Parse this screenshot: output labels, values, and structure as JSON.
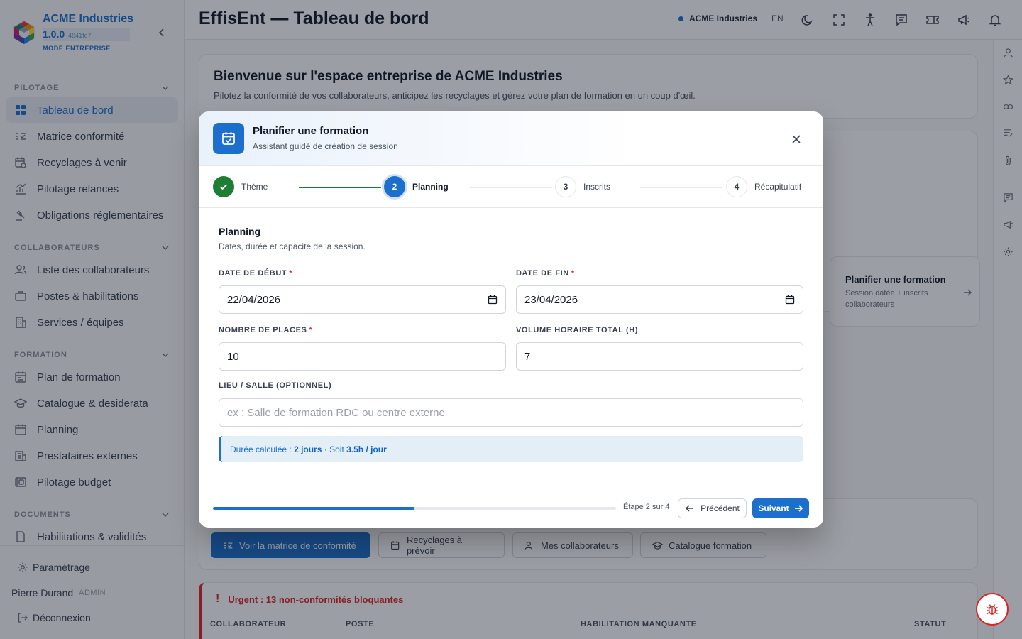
{
  "brand": {
    "name": "ACME Industries",
    "version": "1.0.0",
    "hash": "4841fd7",
    "mode": "MODE ENTREPRISE"
  },
  "sidebar": {
    "sections": [
      {
        "title": "PILOTAGE",
        "items": [
          {
            "label": "Tableau de bord",
            "icon": "dashboard-icon",
            "active": true
          },
          {
            "label": "Matrice conformité",
            "icon": "checklist-icon"
          },
          {
            "label": "Recyclages à venir",
            "icon": "calendar-refresh-icon"
          },
          {
            "label": "Pilotage relances",
            "icon": "chart-icon"
          },
          {
            "label": "Obligations réglementaires",
            "icon": "gavel-icon"
          }
        ]
      },
      {
        "title": "COLLABORATEURS",
        "items": [
          {
            "label": "Liste des collaborateurs",
            "icon": "users-icon"
          },
          {
            "label": "Postes & habilitations",
            "icon": "briefcase-icon"
          },
          {
            "label": "Services / équipes",
            "icon": "building-icon"
          }
        ]
      },
      {
        "title": "FORMATION",
        "items": [
          {
            "label": "Plan de formation",
            "icon": "calendar-plan-icon"
          },
          {
            "label": "Catalogue & desiderata",
            "icon": "graduation-cap-icon"
          },
          {
            "label": "Planning",
            "icon": "calendar-icon"
          },
          {
            "label": "Prestataires externes",
            "icon": "building-icon"
          },
          {
            "label": "Pilotage budget",
            "icon": "budget-icon"
          }
        ]
      },
      {
        "title": "DOCUMENTS",
        "items": [
          {
            "label": "Habilitations & validités",
            "icon": "document-icon"
          }
        ]
      }
    ],
    "footer": {
      "settings_label": "Paramétrage",
      "user_name": "Pierre Durand",
      "user_role": "ADMIN",
      "logout_label": "Déconnexion"
    }
  },
  "topbar": {
    "title": "EffisEnt — Tableau de bord",
    "org": "ACME Industries",
    "lang": "EN",
    "icons": [
      "moon-icon",
      "fullscreen-icon",
      "accessibility-icon",
      "chat-icon",
      "ticket-icon",
      "megaphone-icon",
      "bell-icon"
    ]
  },
  "rail": {
    "icons": [
      "user-icon",
      "star-icon",
      "link-icon",
      "list-edit-icon",
      "paperclip-icon",
      "comment-icon",
      "megaphone-icon",
      "gear-icon"
    ]
  },
  "dashboard": {
    "welcome_title": "Bienvenue sur l'espace entreprise de ACME Industries",
    "welcome_sub": "Pilotez la conformité de vos collaborateurs, anticipez les recyclages et gérez votre plan de formation en un coup d'œil.",
    "shortcut": {
      "title": "Planifier une formation",
      "subtitle": "Session datée + inscrits collaborateurs"
    },
    "quick_actions": [
      {
        "label": "Voir la matrice de conformité",
        "icon": "checklist-icon",
        "primary": true
      },
      {
        "label": "Recyclages à prévoir",
        "icon": "calendar-refresh-icon"
      },
      {
        "label": "Mes collaborateurs",
        "icon": "users-icon"
      },
      {
        "label": "Catalogue formation",
        "icon": "graduation-cap-icon"
      }
    ],
    "urgent": {
      "title": "Urgent : 13 non-conformités bloquantes",
      "columns": [
        "COLLABORATEUR",
        "POSTE",
        "HABILITATION MANQUANTE",
        "STATUT"
      ]
    }
  },
  "modal": {
    "title": "Planifier une formation",
    "subtitle": "Assistant guidé de création de session",
    "steps": [
      {
        "number": "1",
        "label": "Thème",
        "state": "done"
      },
      {
        "number": "2",
        "label": "Planning",
        "state": "current"
      },
      {
        "number": "3",
        "label": "Inscrits",
        "state": "todo"
      },
      {
        "number": "4",
        "label": "Récapitulatif",
        "state": "todo"
      }
    ],
    "section_title": "Planning",
    "section_sub": "Dates, durée et capacité de la session.",
    "fields": {
      "start_date": {
        "label": "DATE DE DÉBUT",
        "required": true,
        "value": "22/04/2026"
      },
      "end_date": {
        "label": "DATE DE FIN",
        "required": true,
        "value": "23/04/2026"
      },
      "seats": {
        "label": "NOMBRE DE PLACES",
        "required": true,
        "value": "10"
      },
      "hours": {
        "label": "VOLUME HORAIRE TOTAL (H)",
        "value": "7"
      },
      "location": {
        "label": "LIEU / SALLE (OPTIONNEL)",
        "value": "",
        "placeholder": "ex : Salle de formation RDC ou centre externe"
      }
    },
    "info": {
      "prefix": "Durée calculée :",
      "days": "2 jours",
      "middle": "· Soit",
      "per_day": "3.5h / jour"
    },
    "footer": {
      "progress_percent": 50,
      "step_count": "Étape 2 sur 4",
      "prev_label": "Précédent",
      "next_label": "Suivant"
    }
  },
  "colors": {
    "primary": "#1d6fce",
    "success": "#1e7e34",
    "danger": "#dc2626"
  }
}
